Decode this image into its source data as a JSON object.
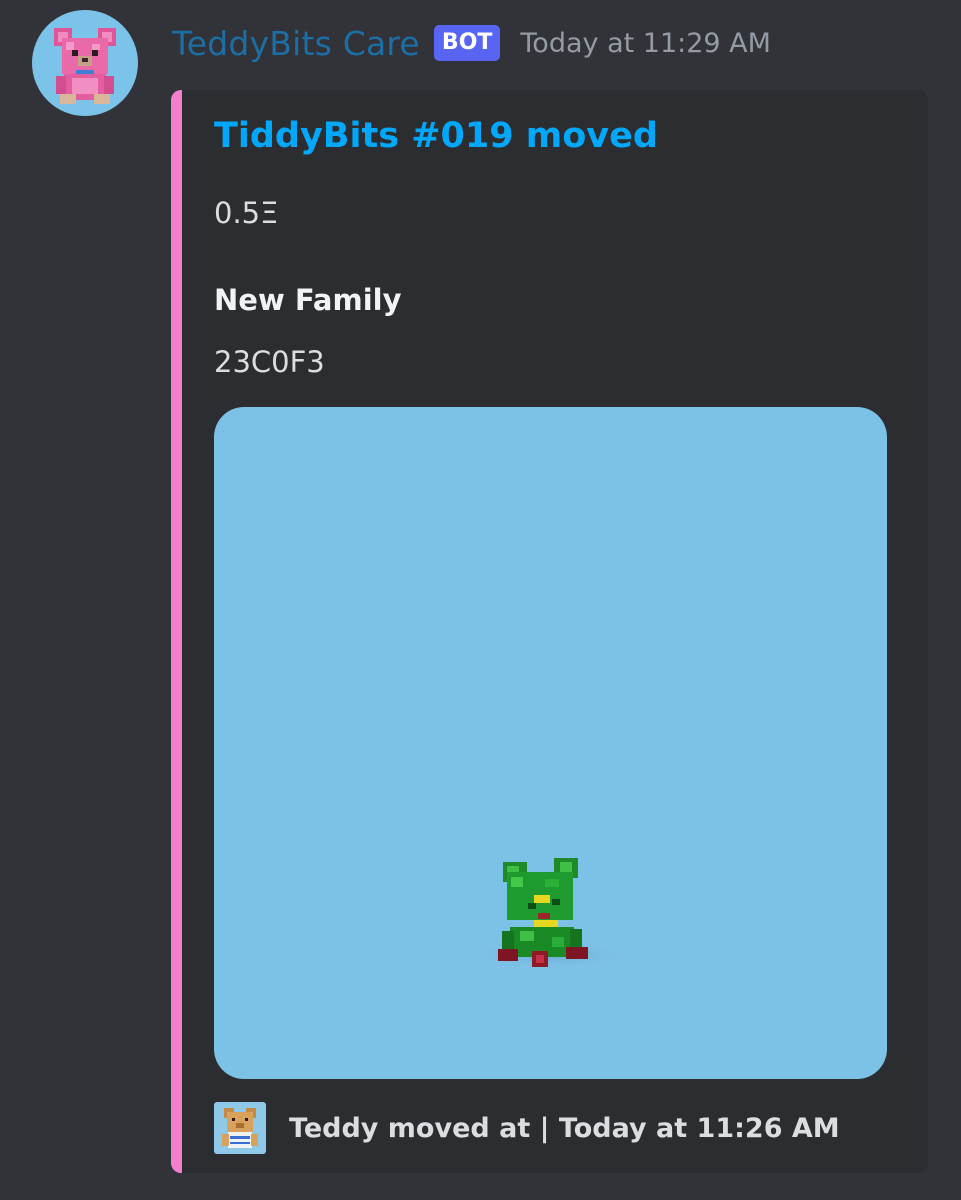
{
  "message": {
    "author": "TeddyBits Care",
    "badge": "BOT",
    "timestamp": "Today at 11:29 AM",
    "avatar_icon": "pink-voxel-teddy-bear-icon"
  },
  "embed": {
    "accent_color": "#f47fcf",
    "title": "TiddyBits #019 moved",
    "description": "0.5Ξ",
    "fields": [
      {
        "name": "New Family",
        "value": "23C0F3"
      }
    ],
    "image_icon": "green-voxel-teddy-bear-icon",
    "image_background": "#7cc1e6",
    "footer": {
      "icon": "tan-voxel-teddy-bear-icon",
      "text": "Teddy moved at | Today at 11:26 AM"
    }
  },
  "colors": {
    "background": "#313338",
    "embed_background": "#2b2d31",
    "author_name": "#1c6ea4",
    "link": "#00a8fc",
    "bot_badge": "#5865f2"
  }
}
